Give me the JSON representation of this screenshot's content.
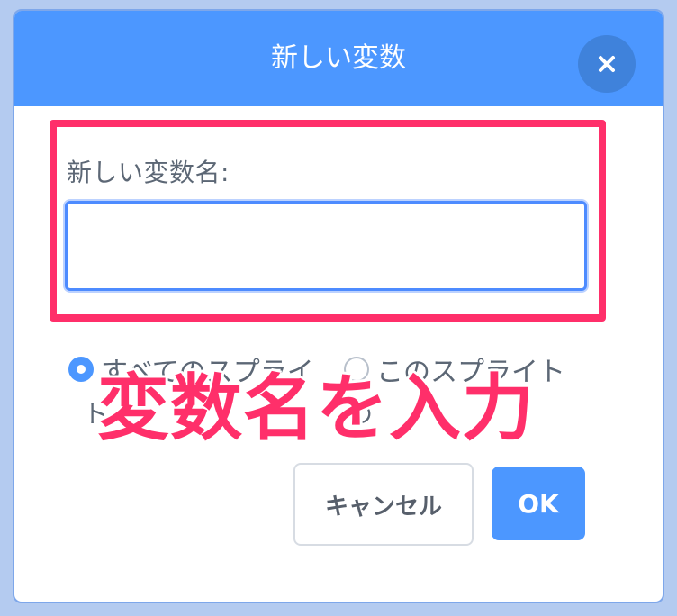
{
  "dialog": {
    "title": "新しい変数",
    "close_icon": "close-icon",
    "field_label": "新しい変数名:",
    "input": {
      "value": "",
      "placeholder": ""
    },
    "radio": {
      "all_sprites_line1": "すべてのスプライ",
      "all_sprites_line2": "ト",
      "this_sprite_line1": "このスプライト",
      "this_sprite_line2": "の"
    },
    "overlay_text": "変数名を入力",
    "buttons": {
      "cancel": "キャンセル",
      "ok": "OK"
    }
  },
  "colors": {
    "header": "#4c97ff",
    "highlight": "#ff2f6a",
    "input_border": "#4d8bff"
  }
}
